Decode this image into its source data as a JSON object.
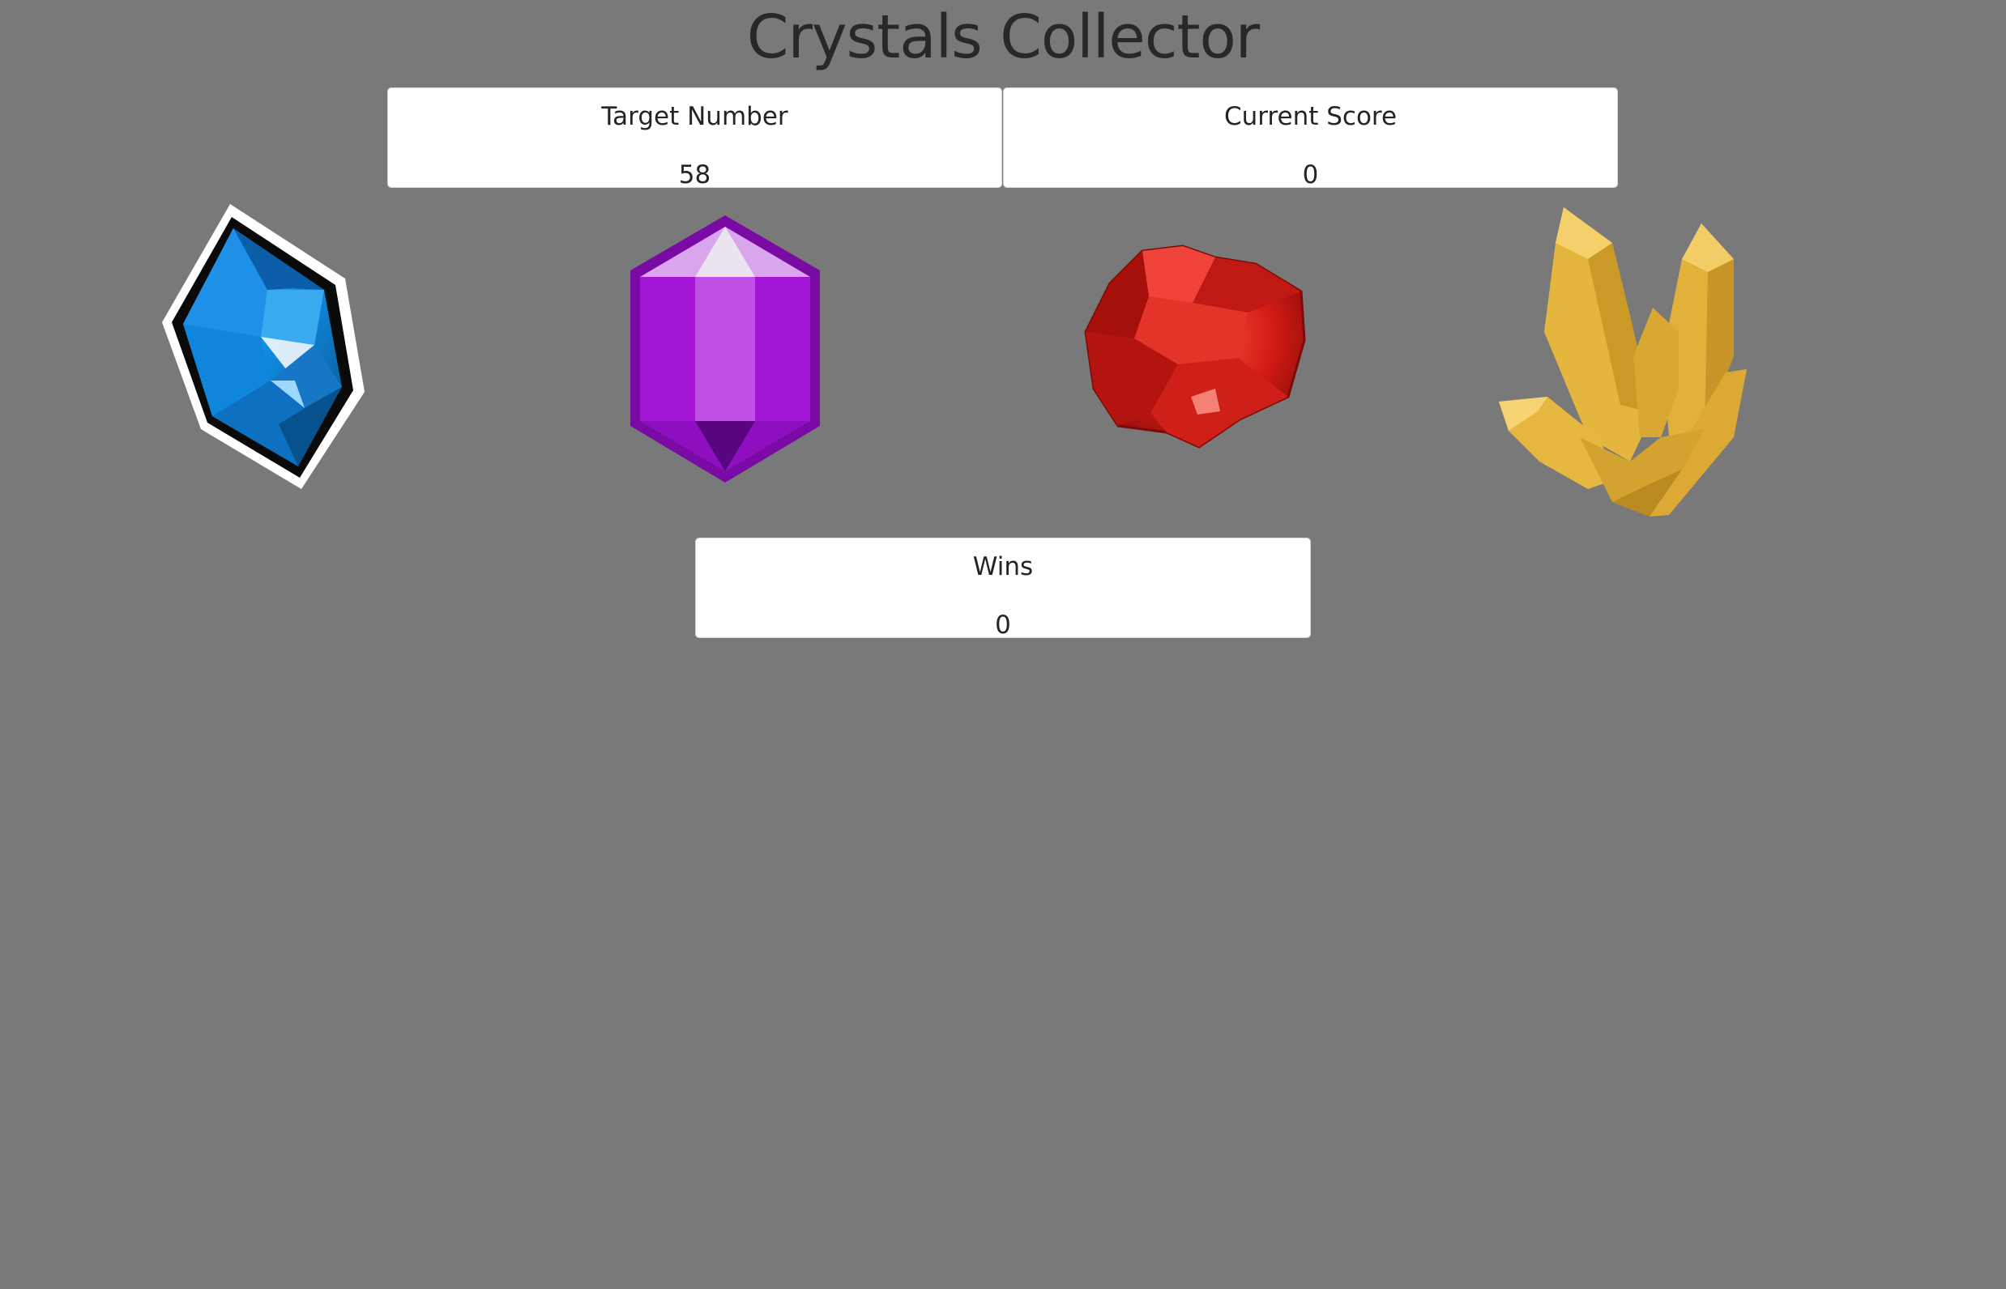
{
  "page": {
    "title": "Crystals Collector",
    "background_color": "#797979"
  },
  "scoreboard": {
    "target_label": "Target Number",
    "target_value": "58",
    "score_label": "Current Score",
    "score_value": "0",
    "wins_label": "Wins",
    "wins_value": "0"
  },
  "crystals": [
    {
      "name": "blue-crystal-icon",
      "color": "#1a8de8"
    },
    {
      "name": "purple-crystal-icon",
      "color": "#a020d8"
    },
    {
      "name": "red-crystal-icon",
      "color": "#d21b14"
    },
    {
      "name": "yellow-crystal-icon",
      "color": "#e0b23a"
    }
  ]
}
